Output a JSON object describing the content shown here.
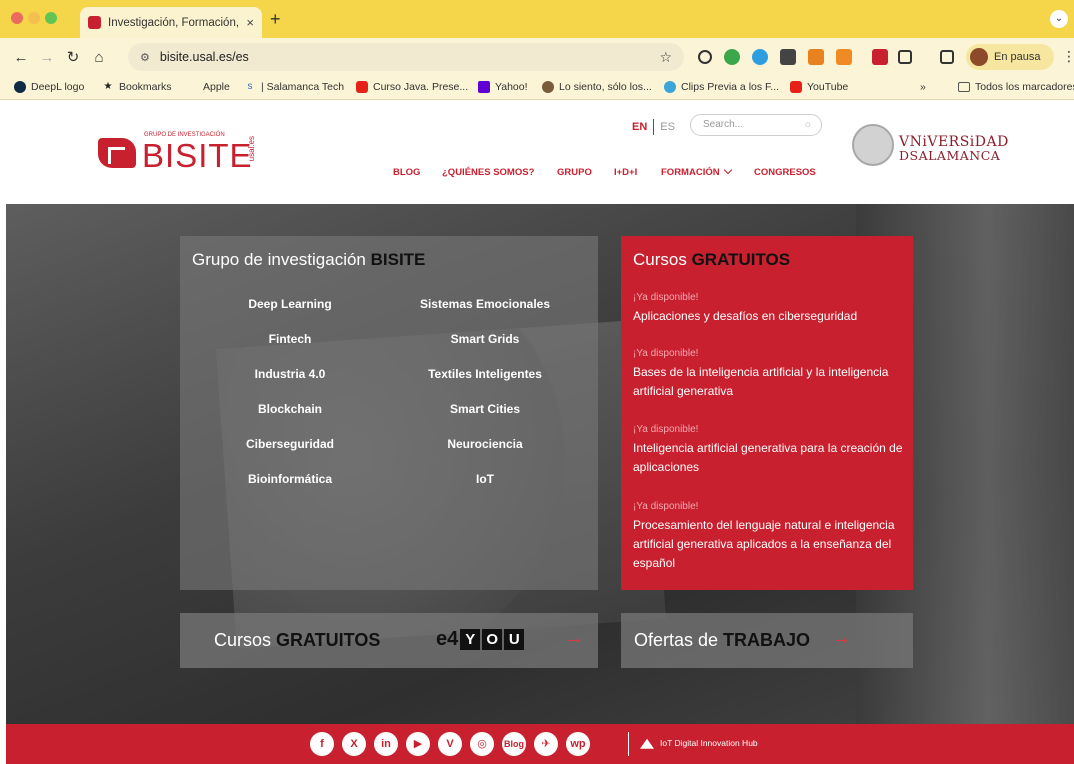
{
  "browser": {
    "tab_title": "Investigación, Formación, Co",
    "tab_close": "×",
    "new_tab": "+",
    "url": "bisite.usal.es/es",
    "profile_label": "En pausa",
    "bookmarks": [
      {
        "label": "DeepL logo",
        "icon": "deepl-icon",
        "color": "#0f2b46"
      },
      {
        "label": "Bookmarks",
        "icon": "star-icon",
        "color": "#222222"
      },
      {
        "label": "Apple",
        "icon": "apple-icon",
        "color": "#222222"
      },
      {
        "label": "| Salamanca Tech",
        "icon": "salamanca-tech-icon",
        "color": "#3a6fb5"
      },
      {
        "label": "Curso Java. Prese...",
        "icon": "youtube-icon",
        "color": "#e62117"
      },
      {
        "label": "Yahoo!",
        "icon": "yahoo-icon",
        "color": "#6001d2"
      },
      {
        "label": "Lo siento, sólo los...",
        "icon": "site-icon",
        "color": "#7a5c3c"
      },
      {
        "label": "Clips Previa a los F...",
        "icon": "clips-icon",
        "color": "#3aa5d8"
      },
      {
        "label": "YouTube",
        "icon": "youtube-icon",
        "color": "#e62117"
      },
      {
        "label": "»",
        "icon": "",
        "color": ""
      },
      {
        "label": "Todos los marcadores",
        "icon": "folder-icon",
        "color": "#555555"
      }
    ]
  },
  "header": {
    "logo_sub": "GRUPO DE INVESTIGACIÓN",
    "logo_word": "BISITE",
    "logo_usal": "usal.es",
    "lang_en": "EN",
    "lang_es": "ES",
    "search_placeholder": "Search...",
    "nav": [
      "BLOG",
      "¿QUIÉNES SOMOS?",
      "GRUPO",
      "I+D+I",
      "FORMACIÓN",
      "CONGRESOS"
    ],
    "uni_line1": "VNiVERSiDAD",
    "uni_line2": "DSALAMANCA"
  },
  "research": {
    "title_plain": "Grupo de investigación ",
    "title_bold": "BISITE",
    "topics_left": [
      "Deep Learning",
      "Fintech",
      "Industria 4.0",
      "Blockchain",
      "Ciberseguridad",
      "Bioinformática"
    ],
    "topics_right": [
      "Sistemas Emocionales",
      "Smart Grids",
      "Textiles Inteligentes",
      "Smart Cities",
      "Neurociencia",
      "IoT"
    ]
  },
  "courses": {
    "title_plain": "Cursos ",
    "title_bold": "GRATUITOS",
    "items": [
      {
        "avail": "¡Ya disponible!",
        "name": "Aplicaciones y desafíos en ciberseguridad"
      },
      {
        "avail": "¡Ya disponible!",
        "name": "Bases de la inteligencia artificial y la inteligencia artificial generativa"
      },
      {
        "avail": "¡Ya disponible!",
        "name": "Inteligencia artificial generativa para la creación de aplicaciones"
      },
      {
        "avail": "¡Ya disponible!",
        "name": "Procesamiento del lenguaje natural e inteligencia artificial generativa aplicados a la enseñanza del español"
      }
    ]
  },
  "cta": {
    "courses_plain": "Cursos ",
    "courses_bold": "GRATUITOS",
    "e4_prefix": "e4",
    "e4_letters": [
      "Y",
      "O",
      "U"
    ],
    "jobs_plain": "Ofertas de ",
    "jobs_bold": "TRABAJO",
    "arrow": "→"
  },
  "footer": {
    "social": [
      {
        "icon": "facebook-icon",
        "glyph": "f"
      },
      {
        "icon": "x-icon",
        "glyph": "X"
      },
      {
        "icon": "linkedin-icon",
        "glyph": "in"
      },
      {
        "icon": "youtube-icon",
        "glyph": "▶"
      },
      {
        "icon": "vimeo-icon",
        "glyph": "V"
      },
      {
        "icon": "instagram-icon",
        "glyph": "◎"
      },
      {
        "icon": "blog-icon",
        "glyph": "Blog"
      },
      {
        "icon": "plane-icon",
        "glyph": "✈"
      },
      {
        "icon": "wordpress-icon",
        "glyph": "wp"
      }
    ],
    "hub": "IoT Digital Innovation Hub"
  },
  "colors": {
    "brand": "#c8202f",
    "tabbar": "#f5d54a"
  }
}
